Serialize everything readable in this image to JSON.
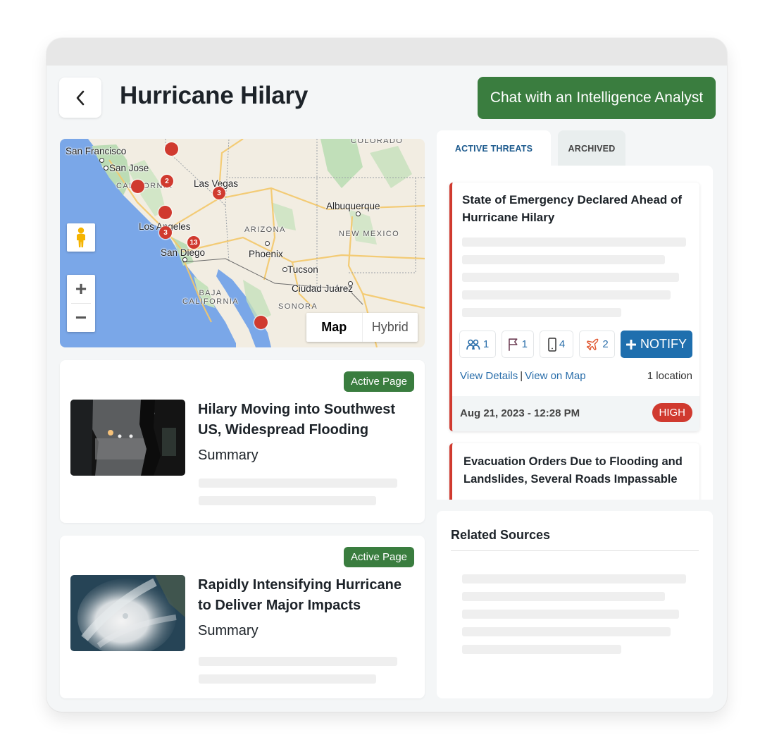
{
  "header": {
    "title": "Hurricane Hilary",
    "back_icon": "chevron-left-icon",
    "chat_button": "Chat with an Intelligence Analyst"
  },
  "map": {
    "labels": {
      "san_francisco": "San Francisco",
      "san_jose": "San Jose",
      "california": "CALIFORNIA",
      "las_vegas": "Las Vegas",
      "colorado": "COLORADO",
      "albuquerque": "Albuquerque",
      "arizona": "ARIZONA",
      "new_mexico": "NEW MEXICO",
      "los_angeles": "Los Angeles",
      "san_diego": "San Diego",
      "phoenix": "Phoenix",
      "tucson": "Tucson",
      "ciudad_juarez": "Ciudad Juárez",
      "baja_california": "BAJA\nCALIFORNIA",
      "sonora": "SONORA"
    },
    "markers": [
      {
        "id": "m1",
        "count": ""
      },
      {
        "id": "m2",
        "count": "2"
      },
      {
        "id": "m3",
        "count": ""
      },
      {
        "id": "m4",
        "count": "3"
      },
      {
        "id": "m5",
        "count": ""
      },
      {
        "id": "m6",
        "count": "3"
      },
      {
        "id": "m7",
        "count": "13"
      },
      {
        "id": "m8",
        "count": ""
      }
    ],
    "zoom_in": "+",
    "zoom_out": "−",
    "map_type_options": [
      "Map",
      "Hybrid"
    ],
    "map_type_selected": "Map"
  },
  "news": [
    {
      "badge": "Active Page",
      "title": "Hilary Moving into Southwest US, Widespread Flooding",
      "summary_label": "Summary",
      "thumbnail": "night-flooding-street-image"
    },
    {
      "badge": "Active Page",
      "title": "Rapidly Intensifying Hurricane to Deliver Major Impacts",
      "summary_label": "Summary",
      "thumbnail": "hurricane-satellite-image"
    }
  ],
  "tabs": [
    {
      "label": "ACTIVE THREATS",
      "active": true
    },
    {
      "label": "ARCHIVED",
      "active": false
    }
  ],
  "threats": [
    {
      "title": "State of Emergency Declared Ahead of Hurricane Hilary",
      "stats": [
        {
          "icon": "people-icon",
          "value": "1",
          "color": "#2a6eaa"
        },
        {
          "icon": "flag-icon",
          "value": "1",
          "color": "#6b3b52"
        },
        {
          "icon": "mobile-phone-icon",
          "value": "4",
          "color": "#333333"
        },
        {
          "icon": "airplane-icon",
          "value": "2",
          "color": "#e0552d"
        }
      ],
      "notify_label": "NOTIFY",
      "view_details": "View Details",
      "separator": "|",
      "view_on_map": "View on Map",
      "location_count": "1 location",
      "date": "Aug 21, 2023 - 12:28 PM",
      "severity": "HIGH"
    },
    {
      "title": "Evacuation Orders Due to Flooding and Landslides, Several Roads Impassable"
    }
  ],
  "related_sources": {
    "title": "Related Sources"
  },
  "colors": {
    "brand_green": "#3a7d3f",
    "accent_blue": "#1f6fae",
    "severity_red": "#d03a2f",
    "link_blue": "#2a6eaa"
  }
}
